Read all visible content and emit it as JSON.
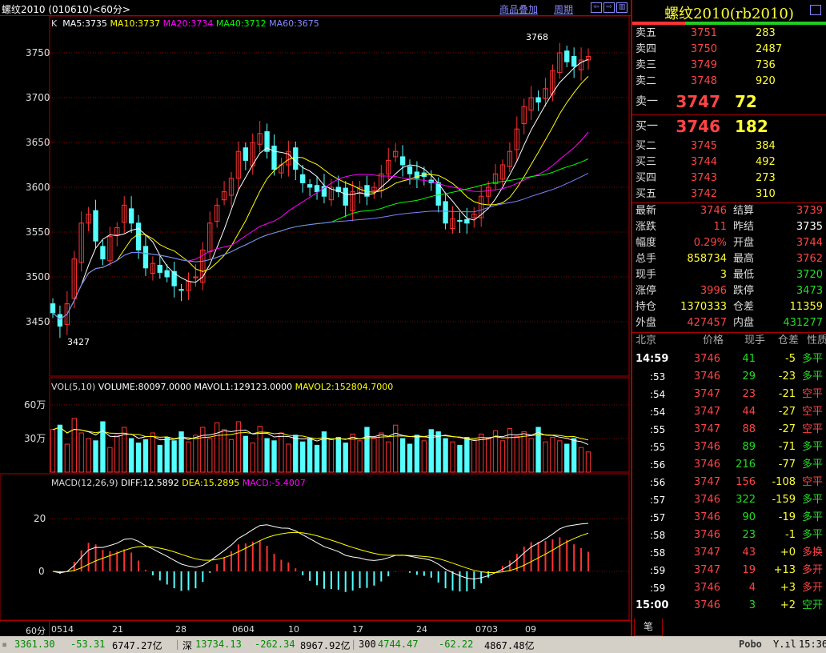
{
  "header": {
    "title": "螺纹2010 (010610)<60分>",
    "overlay_link": "商品叠加",
    "period_link": "周期",
    "btn_left": "⇦",
    "btn_right": "⇨",
    "btn_panel": "▥"
  },
  "legend": {
    "k": "K",
    "ma5": "MA5:3735",
    "ma10": "MA10:3737",
    "ma20": "MA20:3734",
    "ma40": "MA40:3712",
    "ma60": "MA60:3675"
  },
  "vol_legend": {
    "name": "VOL(5,10)",
    "volume": "VOLUME:80097.0000",
    "mavol1": "MAVOL1:129123.0000",
    "mavol2": "MAVOL2:152804.7000"
  },
  "macd_legend": {
    "name": "MACD(12,26,9)",
    "diff": "DIFF:12.5892",
    "dea": "DEA:15.2895",
    "macd": "MACD:-5.4007"
  },
  "annotations": {
    "high": "3768",
    "low": "3427"
  },
  "colors": {
    "ma5": "#ffffff",
    "ma10": "#ffff00",
    "ma20": "#ff00ff",
    "ma40": "#00ff00",
    "ma60": "#8080ff",
    "up": "#ff3232",
    "down": "#54ffff"
  },
  "chart_data": {
    "type": "candlestick",
    "price_ticks": [
      "3750",
      "3700",
      "3650",
      "3600",
      "3550",
      "3500",
      "3450"
    ],
    "price_tick_values": [
      3750,
      3700,
      3650,
      3600,
      3550,
      3500,
      3450
    ],
    "vol_ticks": [
      "60万",
      "30万"
    ],
    "macd_ticks": [
      "20",
      "0"
    ],
    "x_ticks": [
      "60分",
      "0514",
      "21",
      "28",
      "0604",
      "10",
      "17",
      "24",
      "0703",
      "09"
    ],
    "closes": [
      3460,
      3445,
      3470,
      3520,
      3560,
      3570,
      3540,
      3520,
      3545,
      3555,
      3580,
      3560,
      3530,
      3510,
      3515,
      3505,
      3500,
      3490,
      3485,
      3495,
      3500,
      3530,
      3560,
      3580,
      3595,
      3610,
      3640,
      3630,
      3650,
      3660,
      3640,
      3620,
      3625,
      3640,
      3620,
      3605,
      3600,
      3595,
      3590,
      3600,
      3595,
      3580,
      3595,
      3600,
      3590,
      3600,
      3615,
      3630,
      3640,
      3625,
      3615,
      3610,
      3612,
      3605,
      3580,
      3560,
      3565,
      3562,
      3560,
      3570,
      3590,
      3600,
      3615,
      3625,
      3640,
      3665,
      3690,
      3700,
      3695,
      3710,
      3730,
      3750,
      3740,
      3735,
      3742,
      3746
    ],
    "volumes": [
      38,
      42,
      25,
      48,
      35,
      30,
      28,
      45,
      22,
      33,
      40,
      30,
      26,
      29,
      35,
      24,
      31,
      28,
      36,
      27,
      33,
      40,
      30,
      44,
      38,
      29,
      45,
      32,
      26,
      41,
      30,
      28,
      35,
      25,
      33,
      27,
      30,
      24,
      36,
      29,
      31,
      26,
      34,
      28,
      40,
      30,
      35,
      27,
      42,
      30,
      25,
      33,
      28,
      38,
      36,
      30,
      27,
      24,
      31,
      29,
      34,
      30,
      37,
      28,
      39,
      32,
      36,
      30,
      40,
      27,
      31,
      28,
      25,
      30,
      22,
      18
    ]
  },
  "quote": {
    "title": "螺纹2010(rb2010)",
    "asks": [
      {
        "label": "卖五",
        "price": "3751",
        "vol": "283"
      },
      {
        "label": "卖四",
        "price": "3750",
        "vol": "2487"
      },
      {
        "label": "卖三",
        "price": "3749",
        "vol": "736"
      },
      {
        "label": "卖二",
        "price": "3748",
        "vol": "920"
      }
    ],
    "ask1": {
      "label": "卖一",
      "price": "3747",
      "vol": "72"
    },
    "bid1": {
      "label": "买一",
      "price": "3746",
      "vol": "182"
    },
    "bids": [
      {
        "label": "买二",
        "price": "3745",
        "vol": "384"
      },
      {
        "label": "买三",
        "price": "3744",
        "vol": "492"
      },
      {
        "label": "买四",
        "price": "3743",
        "vol": "273"
      },
      {
        "label": "买五",
        "price": "3742",
        "vol": "310"
      }
    ],
    "stats": [
      {
        "l1": "最新",
        "v1": "3746",
        "c1": "red",
        "l2": "结算",
        "v2": "3739",
        "c2": "red"
      },
      {
        "l1": "涨跌",
        "v1": "11",
        "c1": "red",
        "l2": "昨结",
        "v2": "3735",
        "c2": "wht"
      },
      {
        "l1": "幅度",
        "v1": "0.29%",
        "c1": "red",
        "l2": "开盘",
        "v2": "3744",
        "c2": "red"
      },
      {
        "l1": "总手",
        "v1": "858734",
        "c1": "yel",
        "l2": "最高",
        "v2": "3762",
        "c2": "red"
      },
      {
        "l1": "现手",
        "v1": "3",
        "c1": "yel",
        "l2": "最低",
        "v2": "3720",
        "c2": "grn"
      },
      {
        "l1": "涨停",
        "v1": "3996",
        "c1": "red",
        "l2": "跌停",
        "v2": "3473",
        "c2": "grn"
      },
      {
        "l1": "持仓",
        "v1": "1370333",
        "c1": "yel",
        "l2": "仓差",
        "v2": "11359",
        "c2": "yel"
      },
      {
        "l1": "外盘",
        "v1": "427457",
        "c1": "red",
        "l2": "内盘",
        "v2": "431277",
        "c2": "grn"
      }
    ]
  },
  "ticks": {
    "headers": [
      "北京",
      "价格",
      "现手",
      "仓差",
      "性质"
    ],
    "rows": [
      {
        "t": "14:59",
        "p": "3746",
        "v": "41",
        "vc": "grn",
        "d": "-5",
        "n": "多平",
        "nc": "grn"
      },
      {
        "t": ":53",
        "p": "3746",
        "v": "29",
        "vc": "grn",
        "d": "-23",
        "n": "多平",
        "nc": "grn"
      },
      {
        "t": ":54",
        "p": "3747",
        "v": "23",
        "vc": "red",
        "d": "-21",
        "n": "空平",
        "nc": "red"
      },
      {
        "t": ":54",
        "p": "3747",
        "v": "44",
        "vc": "red",
        "d": "-27",
        "n": "空平",
        "nc": "red"
      },
      {
        "t": ":55",
        "p": "3747",
        "v": "88",
        "vc": "red",
        "d": "-27",
        "n": "空平",
        "nc": "red"
      },
      {
        "t": ":55",
        "p": "3746",
        "v": "89",
        "vc": "grn",
        "d": "-71",
        "n": "多平",
        "nc": "grn"
      },
      {
        "t": ":56",
        "p": "3746",
        "v": "216",
        "vc": "grn",
        "d": "-77",
        "n": "多平",
        "nc": "grn"
      },
      {
        "t": ":56",
        "p": "3747",
        "v": "156",
        "vc": "red",
        "d": "-108",
        "n": "空平",
        "nc": "red"
      },
      {
        "t": ":57",
        "p": "3746",
        "v": "322",
        "vc": "grn",
        "d": "-159",
        "n": "多平",
        "nc": "grn"
      },
      {
        "t": ":57",
        "p": "3746",
        "v": "90",
        "vc": "grn",
        "d": "-19",
        "n": "多平",
        "nc": "grn"
      },
      {
        "t": ":58",
        "p": "3746",
        "v": "23",
        "vc": "grn",
        "d": "-1",
        "n": "多平",
        "nc": "grn"
      },
      {
        "t": ":58",
        "p": "3747",
        "v": "43",
        "vc": "red",
        "d": "+0",
        "n": "多换",
        "nc": "red"
      },
      {
        "t": ":59",
        "p": "3747",
        "v": "19",
        "vc": "red",
        "d": "+13",
        "n": "多开",
        "nc": "red"
      },
      {
        "t": ":59",
        "p": "3746",
        "v": "4",
        "vc": "red",
        "d": "+3",
        "n": "多开",
        "nc": "red"
      },
      {
        "t": "15:00",
        "p": "3746",
        "v": "3",
        "vc": "grn",
        "d": "+2",
        "n": "空开",
        "nc": "grn"
      }
    ],
    "tab": "笔"
  },
  "status": {
    "sh_index": "3361.30",
    "sh_chg": "-53.31",
    "sh_amt": "6747.27亿",
    "sz_label": "深",
    "sz_index": "13734.13",
    "sz_chg": "-262.34",
    "sz_amt": "8967.92亿",
    "hs_label": "300",
    "hs_index": "4744.47",
    "hs_chg": "-62.22",
    "hs_amt": "4867.48亿",
    "brand": "Pobo",
    "signal": "Y.ıl",
    "time": "15:36"
  }
}
